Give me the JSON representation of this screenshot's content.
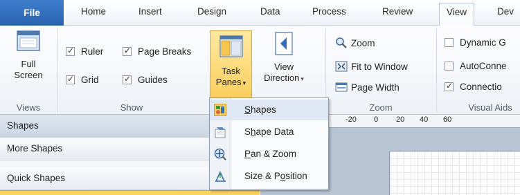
{
  "tabs": {
    "file": "File",
    "home": "Home",
    "insert": "Insert",
    "design": "Design",
    "data": "Data",
    "process": "Process",
    "review": "Review",
    "view": "View",
    "developer": "Dev"
  },
  "ribbon": {
    "views": {
      "full_screen_line1": "Full",
      "full_screen_line2": "Screen",
      "label": "Views"
    },
    "show": {
      "ruler": "Ruler",
      "page_breaks": "Page Breaks",
      "grid": "Grid",
      "guides": "Guides",
      "task_panes_line1": "Task",
      "task_panes_line2": "Panes",
      "label": "Show"
    },
    "view_direction": {
      "line1": "View",
      "line2": "Direction"
    },
    "zoom": {
      "zoom": "Zoom",
      "fit_to_window": "Fit to Window",
      "page_width": "Page Width",
      "label": "Zoom"
    },
    "visual_aids": {
      "dynamic_grid": "Dynamic G",
      "autoconnect": "AutoConne",
      "connection": "Connectio",
      "label": "Visual Aids"
    },
    "dropdown_arrow": "▾"
  },
  "menu": {
    "items": [
      {
        "label": "Shapes",
        "icon": "shapes-icon",
        "underline": "S"
      },
      {
        "label": "Shape Data",
        "icon": "shape-data-icon",
        "underline": "h"
      },
      {
        "label": "Pan & Zoom",
        "icon": "pan-zoom-icon",
        "underline": "P"
      },
      {
        "label": "Size & Position",
        "icon": "size-position-icon",
        "underline": "o"
      }
    ]
  },
  "pane": {
    "shapes": "Shapes",
    "more_shapes": "More Shapes",
    "quick_shapes": "Quick Shapes"
  },
  "ruler": {
    "labels": [
      "-20",
      "0",
      "20",
      "40",
      "60"
    ]
  }
}
